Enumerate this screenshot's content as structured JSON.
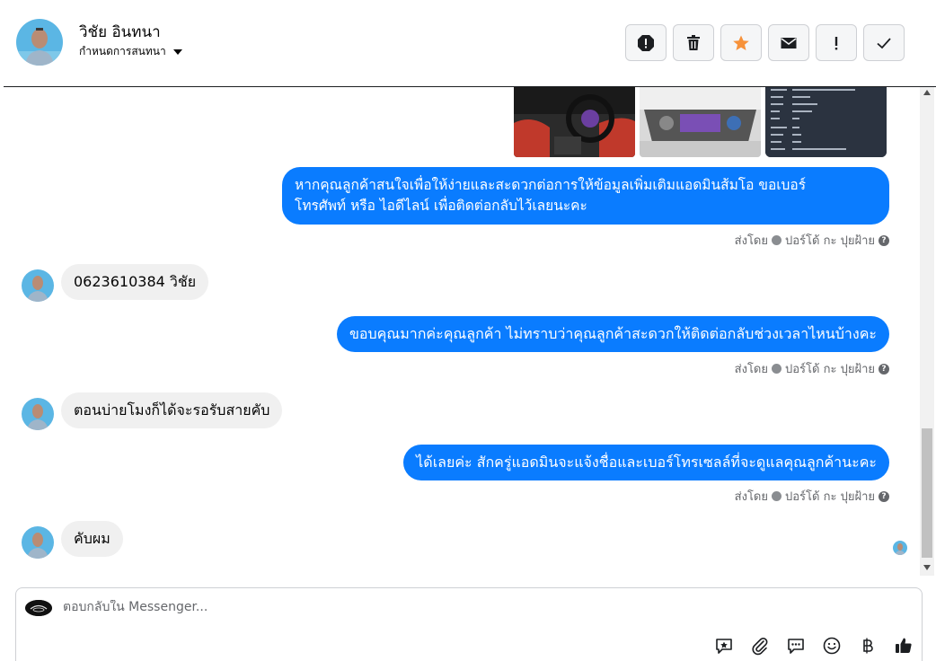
{
  "header": {
    "contact_name": "วิชัย อินทนา",
    "assign_label": "กำหนดการสนทนา",
    "actions": [
      {
        "name": "report-icon"
      },
      {
        "name": "trash-icon"
      },
      {
        "name": "star-icon"
      },
      {
        "name": "envelope-icon"
      },
      {
        "name": "exclamation-icon"
      },
      {
        "name": "check-icon"
      }
    ]
  },
  "colors": {
    "outgoing_bubble": "#0a7cff",
    "incoming_bubble": "#f0f0f0",
    "star": "#f7923a"
  },
  "messages": [
    {
      "dir": "out",
      "text_lines": [
        "หากคุณลูกค้าสนใจเพื่อให้ง่ายและสะดวกต่อการให้ข้อมูลเพิ่มเติมแอดมินส้มโอ ขอเบอร์",
        "โทรศัพท์ หรือ ไอดีไลน์ เพื่อติดต่อกลับไว้เลยนะคะ"
      ]
    },
    {
      "dir": "in",
      "text": "0623610384 วิชัย"
    },
    {
      "dir": "out",
      "text": "ขอบคุณมากค่ะคุณลูกค้า ไม่ทราบว่าคุณลูกค้าสะดวกให้ติดต่อกลับช่วงเวลาไหนบ้างคะ"
    },
    {
      "dir": "in",
      "text": "ตอนบ่ายโมงก็ได้จะรอรับสายคับ"
    },
    {
      "dir": "out",
      "text": "ได้เลยค่ะ สักครู่แอดมินจะแจ้งชื่อและเบอร์โทรเซลล์ที่จะดูแลคุณลูกค้านะคะ"
    },
    {
      "dir": "in",
      "text": "คับผม"
    }
  ],
  "sent_by": {
    "prefix": "ส่งโดย",
    "name": "ปอร์โด้ กะ ปุยฝ้าย"
  },
  "composer": {
    "placeholder": "ตอบกลับใน Messenger...",
    "tools": [
      "saved-reply-icon",
      "attachment-icon",
      "chat-bubble-icon",
      "emoji-icon",
      "baht-icon",
      "thumbs-up-icon"
    ]
  }
}
